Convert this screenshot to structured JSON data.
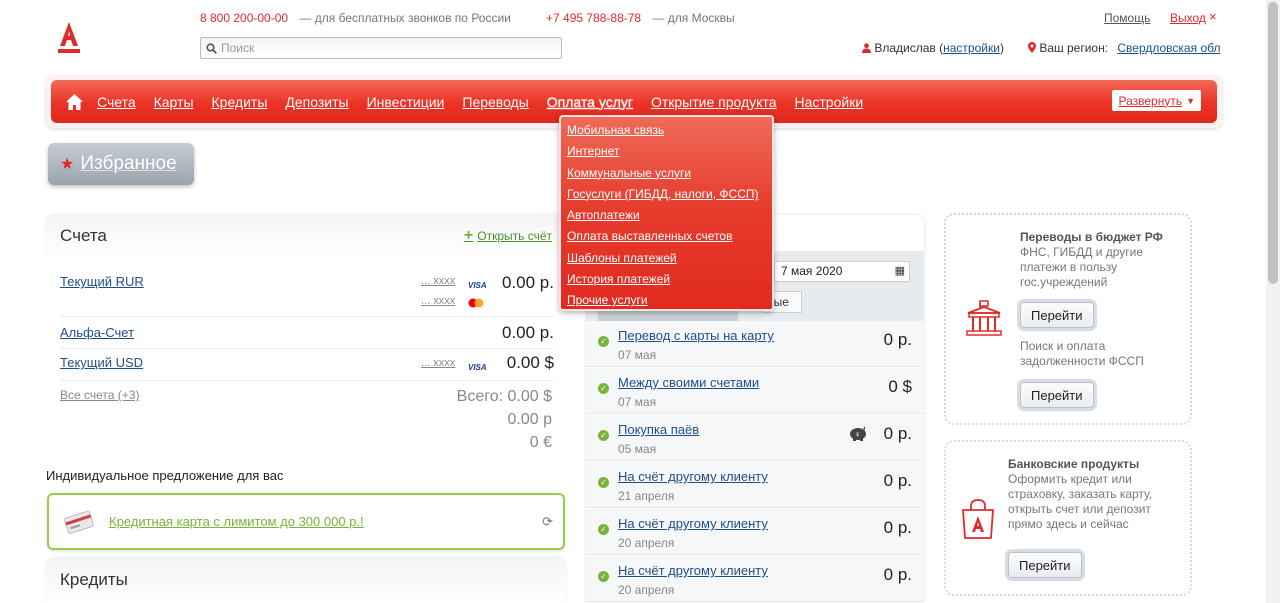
{
  "header": {
    "phone1": "8 800 200-00-00",
    "phone1_note": "— для бесплатных звонков по России",
    "phone2": "+7 495 788-88-78",
    "phone2_note": "— для Москвы",
    "search_placeholder": "Поиск",
    "help": "Помощь",
    "exit": "Выход",
    "user_name": "Владислав",
    "settings": "настройки",
    "region_label": "Ваш регион:",
    "region_value": "Свердловская обл"
  },
  "nav": {
    "items": [
      "Счета",
      "Карты",
      "Кредиты",
      "Депозиты",
      "Инвестиции",
      "Переводы",
      "Оплата услуг",
      "Открытие продукта",
      "Настройки"
    ],
    "expand": "Развернуть"
  },
  "dropdown": {
    "items": [
      "Мобильная связь",
      "Интернет",
      "Коммунальные услуги",
      "Госуслуги (ГИБДД, налоги, ФССП)",
      "Автоплатежи",
      "Оплата выставленных счетов",
      "Шаблоны платежей",
      "История платежей",
      "Прочие услуги"
    ]
  },
  "favorites": {
    "label": "Избранное"
  },
  "accounts": {
    "title": "Счета",
    "open": "Открыть счёт",
    "rows": [
      {
        "name": "Текущий RUR",
        "mask1": "... xxxx",
        "mask2": "... xxxx",
        "amount": "0.00 р."
      },
      {
        "name": "Альфа-Счет",
        "amount": "0.00 р."
      },
      {
        "name": "Текущий USD",
        "mask1": "... xxxx",
        "amount": "0.00 $"
      }
    ],
    "all": "Все счета (+3)",
    "total1": "Всего: 0.00 $",
    "total2": "0.00 р",
    "total3": "0 €"
  },
  "offer": {
    "title": "Индивидуальное предложение для вас",
    "link": "Кредитная карта с лимитом до 300 000 р.!"
  },
  "credits": {
    "title": "Кредиты"
  },
  "history": {
    "date": "7 мая 2020",
    "filter_label": "ные",
    "transactions": [
      {
        "name": "Перевод с карты на карту",
        "date": "07 мая",
        "amount": "0 р."
      },
      {
        "name": "Между своими счетами",
        "date": "07 мая",
        "amount": "0 $"
      },
      {
        "name": "Покупка паёв",
        "date": "05 мая",
        "amount": "0 р."
      },
      {
        "name": "На счёт другому клиенту",
        "date": "21 апреля",
        "amount": "0 р."
      },
      {
        "name": "На счёт другому клиенту",
        "date": "20 апреля",
        "amount": "0 р."
      },
      {
        "name": "На счёт другому клиенту",
        "date": "20 апреля",
        "amount": "0 р."
      }
    ]
  },
  "budget": {
    "title": "Переводы в бюджет РФ",
    "text1": "ФНС, ГИБДД и другие платежи в пользу гос.учреждений",
    "btn1": "Перейти",
    "text2": "Поиск и оплата задолженности ФССП",
    "btn2": "Перейти"
  },
  "products": {
    "title": "Банковские продукты",
    "text": "Оформить кредит или страховку, заказать карту, открыть счет или депозит прямо здесь и сейчас",
    "btn": "Перейти"
  },
  "colors": {
    "brand_red": "#e02b2b",
    "accent_green": "#7ab33a",
    "link_blue": "#1d4f8c"
  }
}
